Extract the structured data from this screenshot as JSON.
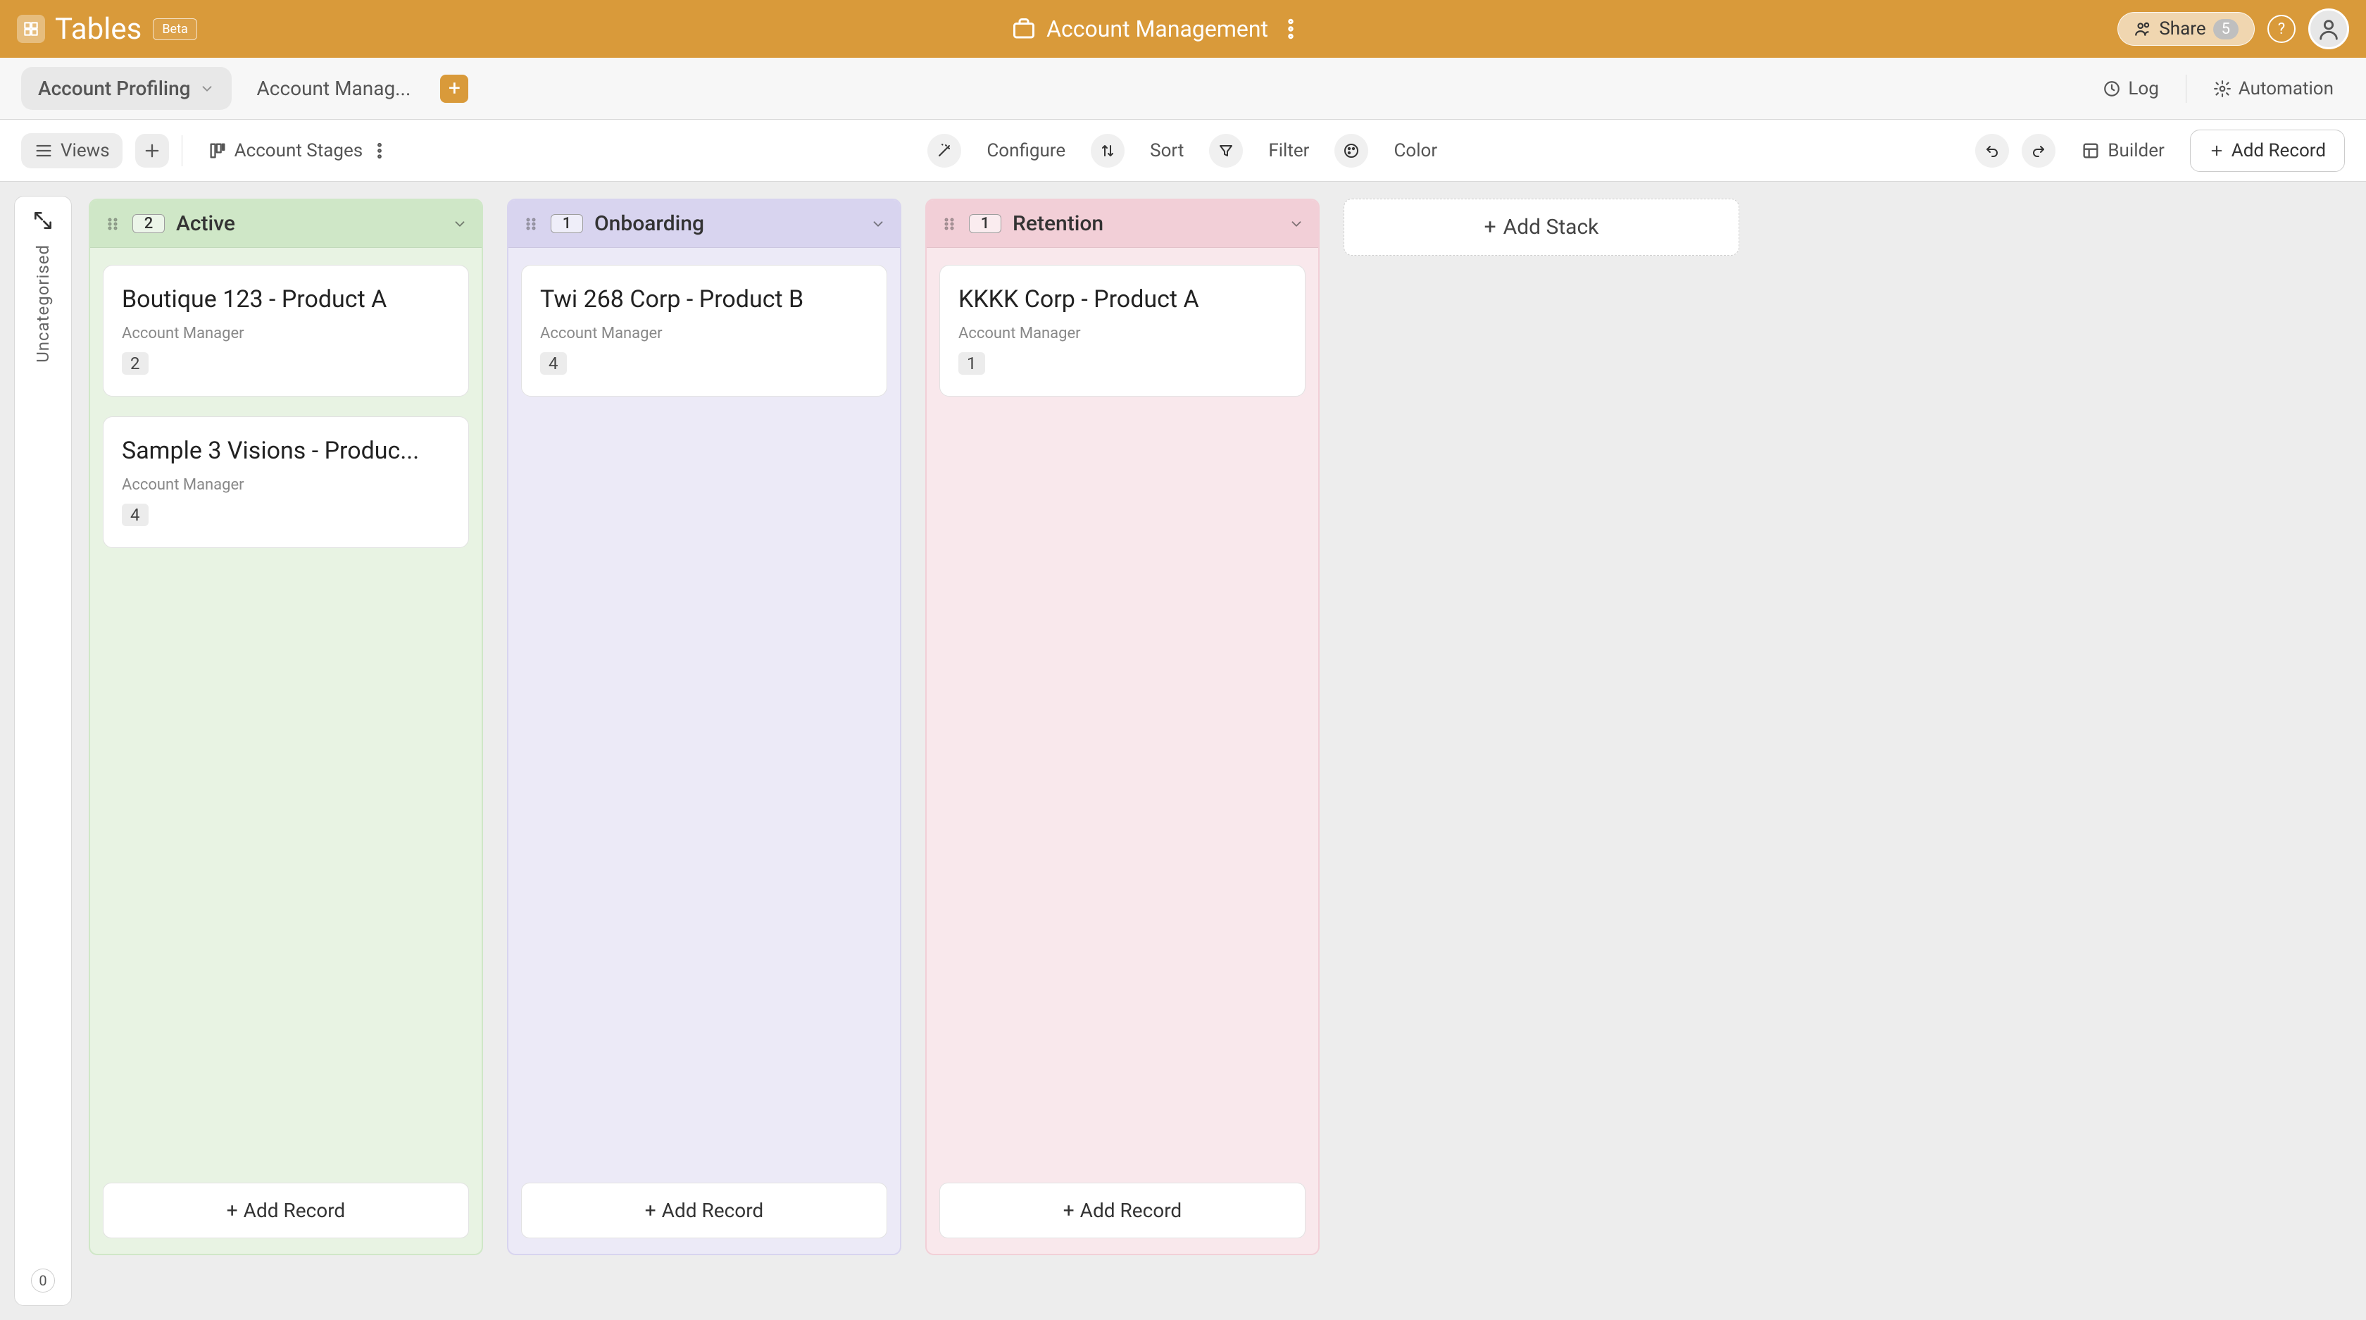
{
  "topbar": {
    "app_name": "Tables",
    "beta_label": "Beta",
    "page_title": "Account Management",
    "share_label": "Share",
    "share_count": "5"
  },
  "tabs": {
    "active_tab_label": "Account Profiling",
    "second_tab_label": "Account Manag...",
    "log_label": "Log",
    "automation_label": "Automation"
  },
  "toolbar": {
    "views_label": "Views",
    "view_name": "Account Stages",
    "configure_label": "Configure",
    "sort_label": "Sort",
    "filter_label": "Filter",
    "color_label": "Color",
    "builder_label": "Builder",
    "add_record_label": "Add Record"
  },
  "uncategorised": {
    "label": "Uncategorised",
    "count": "0"
  },
  "stacks": [
    {
      "name": "Active",
      "count": "2",
      "color": "green",
      "cards": [
        {
          "title": "Boutique 123 - Product A",
          "sub_label": "Account Manager",
          "chip": "2"
        },
        {
          "title": "Sample 3 Visions - Produc...",
          "sub_label": "Account Manager",
          "chip": "4"
        }
      ],
      "add_record_label": "Add Record"
    },
    {
      "name": "Onboarding",
      "count": "1",
      "color": "purple",
      "cards": [
        {
          "title": "Twi 268 Corp - Product B",
          "sub_label": "Account Manager",
          "chip": "4"
        }
      ],
      "add_record_label": "Add Record"
    },
    {
      "name": "Retention",
      "count": "1",
      "color": "pink",
      "cards": [
        {
          "title": "KKKK Corp - Product A",
          "sub_label": "Account Manager",
          "chip": "1"
        }
      ],
      "add_record_label": "Add Record"
    }
  ],
  "add_stack_label": "Add Stack"
}
